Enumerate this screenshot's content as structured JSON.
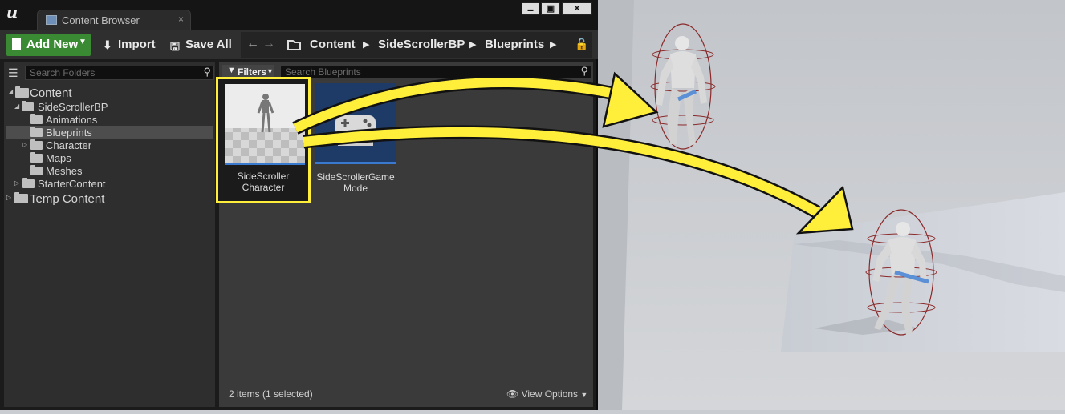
{
  "window": {
    "tab_title": "Content Browser",
    "tab_close": "×",
    "minimize": "▬",
    "maximize": "▣",
    "close": "✕"
  },
  "toolbar": {
    "add_new": "Add New",
    "import": "Import",
    "save_all": "Save All"
  },
  "breadcrumb": [
    "Content",
    "SideScrollerBP",
    "Blueprints"
  ],
  "folders_search": {
    "placeholder": "Search Folders"
  },
  "tree": {
    "items": [
      {
        "label": "Content"
      },
      {
        "label": "SideScrollerBP"
      },
      {
        "label": "Animations"
      },
      {
        "label": "Blueprints"
      },
      {
        "label": "Character"
      },
      {
        "label": "Maps"
      },
      {
        "label": "Meshes"
      },
      {
        "label": "StarterContent"
      },
      {
        "label": "Temp Content"
      }
    ],
    "selected": "Blueprints"
  },
  "filters": {
    "label": "Filters"
  },
  "assets_search": {
    "placeholder": "Search Blueprints"
  },
  "assets": [
    {
      "line1": "SideScroller",
      "line2": "Character",
      "selected": true
    },
    {
      "line1": "SideScrollerGame",
      "line2": "Mode",
      "selected": false
    }
  ],
  "status": {
    "items": "2 items (1 selected)"
  },
  "view_options": {
    "label": "View Options"
  },
  "colors": {
    "highlight_yellow": "#ffee3a",
    "add_green": "#3a8a33",
    "selection_blue": "#3b79cf"
  }
}
